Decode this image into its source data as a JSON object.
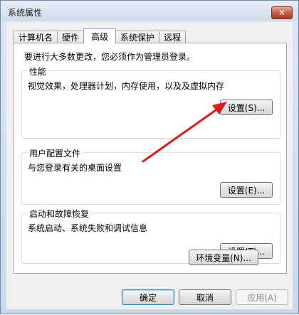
{
  "window": {
    "title": "系统属性",
    "close_label": "✕"
  },
  "tabs": [
    {
      "label": "计算机名",
      "active": false
    },
    {
      "label": "硬件",
      "active": false
    },
    {
      "label": "高级",
      "active": true
    },
    {
      "label": "系统保护",
      "active": false
    },
    {
      "label": "远程",
      "active": false
    }
  ],
  "advanced": {
    "admin_note": "要进行大多数更改，您必须作为管理员登录。",
    "performance": {
      "title": "性能",
      "description": "视觉效果，处理器计划，内存使用，以及及虚拟内存",
      "button": "设置(S)..."
    },
    "user_profiles": {
      "title": "用户配置文件",
      "description": "与您登录有关的桌面设置",
      "button": "设置(E)..."
    },
    "startup_recovery": {
      "title": "启动和故障恢复",
      "description": "系统启动、系统失败和调试信息",
      "button": "设置(T)..."
    },
    "env_vars_button": "环境变量(N)..."
  },
  "footer": {
    "ok": "确定",
    "cancel": "取消",
    "apply": "应用(A)"
  },
  "colors": {
    "arrow": "#d91c1c"
  }
}
